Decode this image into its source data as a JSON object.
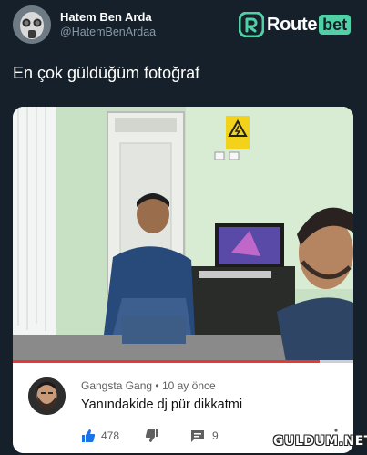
{
  "tweet": {
    "author": {
      "display_name": "Hatem Ben Arda",
      "handle": "@HatemBenArdaa",
      "avatar_icon": "gas-mask-avatar"
    },
    "text": "En çok güldüğüm fotoğraf"
  },
  "brand": {
    "route": "Route",
    "bet": "bet",
    "icon": "routebet-r-icon",
    "accent": "#4fd1a5"
  },
  "video": {
    "progress": 0.9,
    "progress_color": "#e53935",
    "warning_sign": "high-voltage-sign"
  },
  "comment": {
    "author": "Gangsta Gang",
    "separator": "•",
    "time": "10 ay önce",
    "text": "Yanındakide dj pür dikkatmi",
    "likes": "478",
    "replies": "9",
    "icons": [
      "thumbs-up-icon",
      "thumbs-down-icon",
      "reply-icon",
      "more-vertical-icon"
    ]
  },
  "watermark": "GULDUM.NET",
  "colors": {
    "background": "#15202b",
    "secondary_text": "#8899a6",
    "like_blue": "#1a73e8"
  }
}
